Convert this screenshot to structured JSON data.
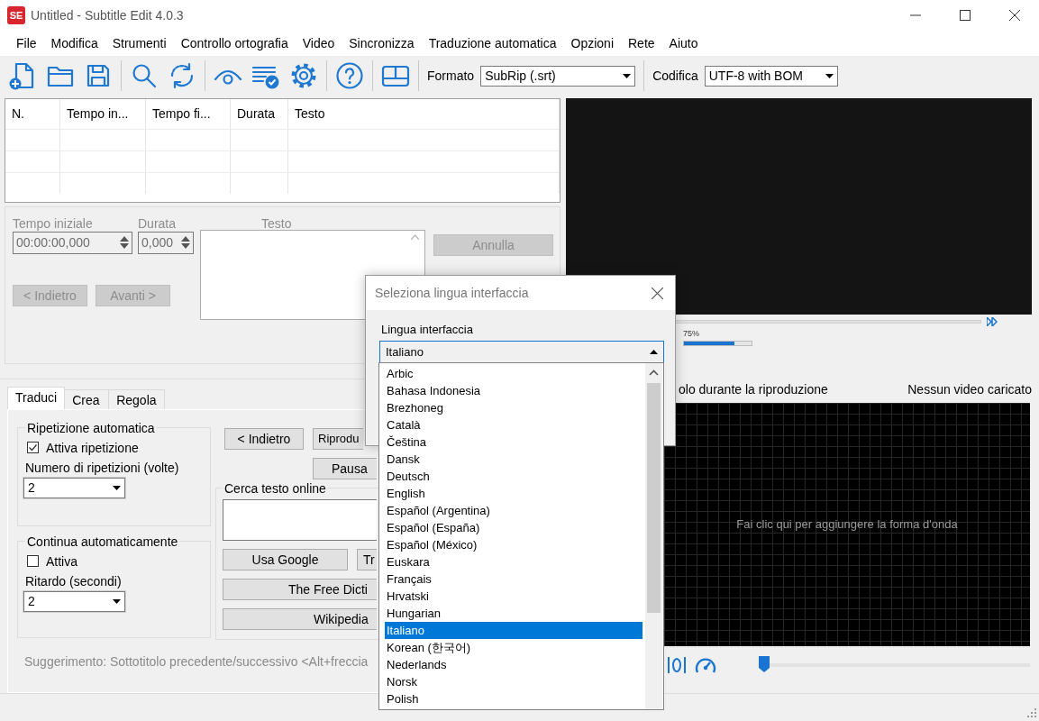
{
  "window": {
    "app_icon_text": "SE",
    "title": "Untitled - Subtitle Edit 4.0.3"
  },
  "menu": [
    "File",
    "Modifica",
    "Strumenti",
    "Controllo ortografia",
    "Video",
    "Sincronizza",
    "Traduzione automatica",
    "Opzioni",
    "Rete",
    "Aiuto"
  ],
  "toolbar": {
    "format_label": "Formato",
    "format_value": "SubRip (.srt)",
    "encoding_label": "Codifica",
    "encoding_value": "UTF-8 with BOM"
  },
  "table": {
    "columns": [
      "N.",
      "Tempo in...",
      "Tempo fi...",
      "Durata",
      "Testo"
    ]
  },
  "edit_panel": {
    "disabled": true,
    "start_label": "Tempo iniziale",
    "start_value": "00:00:00,000",
    "duration_label": "Durata",
    "duration_value": "0,000",
    "text_label": "Testo",
    "undo_button": "Annulla",
    "prev_button": "< Indietro",
    "next_button": "Avanti >"
  },
  "bottom_tabs": [
    {
      "label": "Traduci",
      "selected": true
    },
    {
      "label": "Crea",
      "selected": false
    },
    {
      "label": "Regola",
      "selected": false
    }
  ],
  "translate": {
    "repeat": {
      "title": "Ripetizione automatica",
      "checkbox": {
        "label": "Attiva ripetizione",
        "checked": true
      },
      "count_label": "Numero di ripetizioni (volte)",
      "count_value": "2"
    },
    "continue": {
      "title": "Continua automaticamente",
      "checkbox": {
        "label": "Attiva",
        "checked": false
      },
      "delay_label": "Ritardo (secondi)",
      "delay_value": "2"
    },
    "nav_buttons": [
      "< Indietro",
      "Riprodu",
      "Pausa"
    ],
    "search": {
      "title": "Cerca testo online",
      "buttons": [
        "Usa Google",
        "Tr",
        "The Free Dicti",
        "Wikipedia"
      ]
    },
    "hint": "Suggerimento: Sottotitolo precedente/successivo <Alt+freccia"
  },
  "video": {
    "volume_label": "75%",
    "volume": {
      "level": 0.75
    },
    "playback_option": "olo durante la riproduzione",
    "status": "Nessun video caricato",
    "waveform_hint": "Fai clic qui per aggiungere la forma d'onda",
    "position": {
      "level": 0
    }
  },
  "dialog": {
    "title": "Seleziona lingua interfaccia",
    "label": "Lingua interfaccia",
    "value": "Italiano",
    "languages": [
      {
        "label": "Arbic",
        "selected": false
      },
      {
        "label": "Bahasa Indonesia",
        "selected": false
      },
      {
        "label": "Brezhoneg",
        "selected": false
      },
      {
        "label": "Català",
        "selected": false
      },
      {
        "label": "Čeština",
        "selected": false
      },
      {
        "label": "Dansk",
        "selected": false
      },
      {
        "label": "Deutsch",
        "selected": false
      },
      {
        "label": "English",
        "selected": false
      },
      {
        "label": "Español (Argentina)",
        "selected": false
      },
      {
        "label": "Español (España)",
        "selected": false
      },
      {
        "label": "Español (México)",
        "selected": false
      },
      {
        "label": "Euskara",
        "selected": false
      },
      {
        "label": "Français",
        "selected": false
      },
      {
        "label": "Hrvatski",
        "selected": false
      },
      {
        "label": "Hungarian",
        "selected": false
      },
      {
        "label": "Italiano",
        "selected": true
      },
      {
        "label": "Korean (한국어)",
        "selected": false
      },
      {
        "label": "Nederlands",
        "selected": false
      },
      {
        "label": "Norsk",
        "selected": false
      },
      {
        "label": "Polish",
        "selected": false
      }
    ]
  }
}
